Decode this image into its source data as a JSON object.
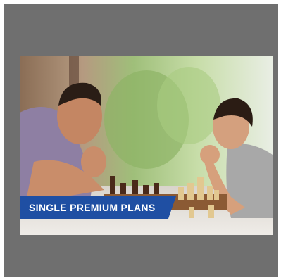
{
  "banner": {
    "label": "SINGLE PREMIUM PLANS"
  },
  "image": {
    "icon": "father-son-chess-photo"
  },
  "colors": {
    "frame": "#6f6f6f",
    "banner": "#1f4fa3",
    "banner_text": "#ffffff"
  }
}
